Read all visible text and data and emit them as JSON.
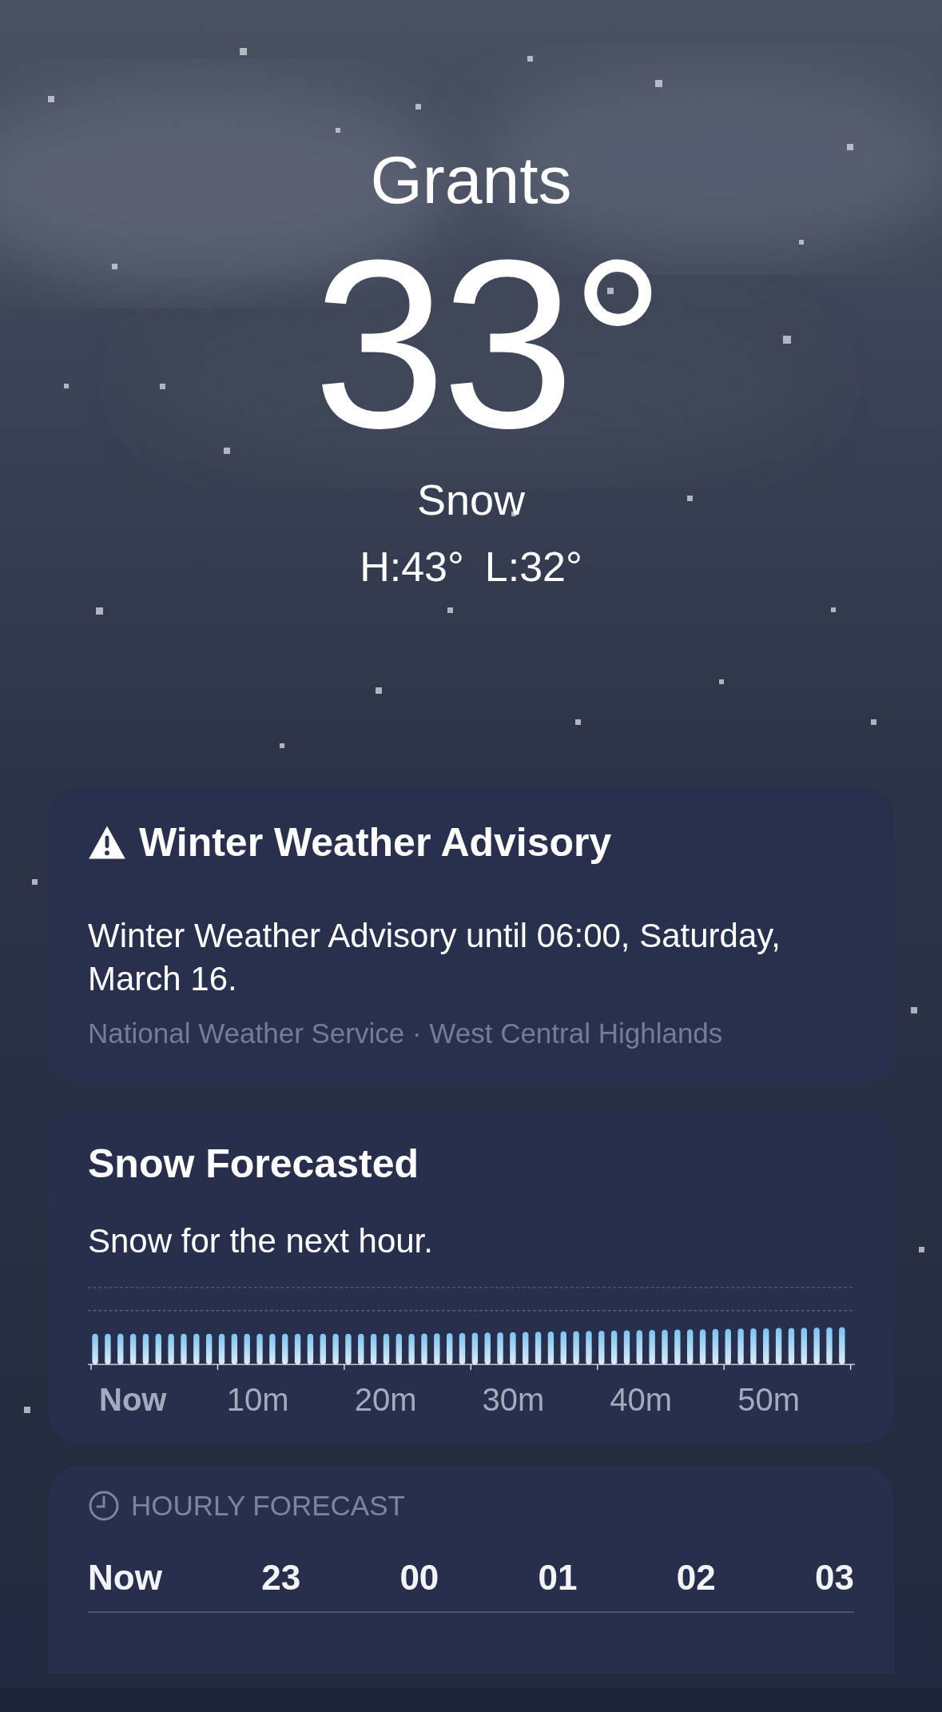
{
  "location": {
    "city": "Grants",
    "temperature": "33°",
    "condition": "Snow",
    "high": "H:43°",
    "low": "L:32°"
  },
  "alert": {
    "title": "Winter Weather Advisory",
    "text": "Winter Weather Advisory until 06:00, Saturday, March 16.",
    "source": "National Weather Service · West Central Highlands"
  },
  "precipitation": {
    "title": "Snow Forecasted",
    "summary": "Snow for the next hour.",
    "labels": [
      {
        "text": "Now",
        "selected": true
      },
      {
        "text": "10m",
        "selected": false
      },
      {
        "text": "20m",
        "selected": false
      },
      {
        "text": "30m",
        "selected": false
      },
      {
        "text": "40m",
        "selected": false
      },
      {
        "text": "50m",
        "selected": false
      }
    ]
  },
  "hourly": {
    "title": "HOURLY FORECAST",
    "hours": [
      {
        "time": "Now"
      },
      {
        "time": "23"
      },
      {
        "time": "00"
      },
      {
        "time": "01"
      },
      {
        "time": "02"
      },
      {
        "time": "03"
      }
    ]
  }
}
